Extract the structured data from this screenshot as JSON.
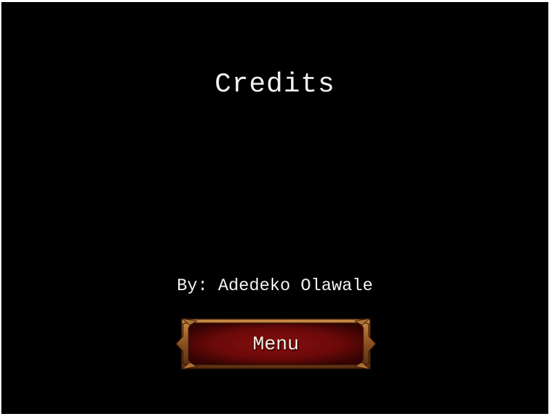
{
  "screen": {
    "title": "Credits",
    "author_line": "By: Adedeko Olawale",
    "menu_button_label": "Menu"
  },
  "colors": {
    "background": "#000000",
    "text": "#f2f2f2",
    "button_fill": "#8a0d0d",
    "button_frame": "#a8682a"
  }
}
